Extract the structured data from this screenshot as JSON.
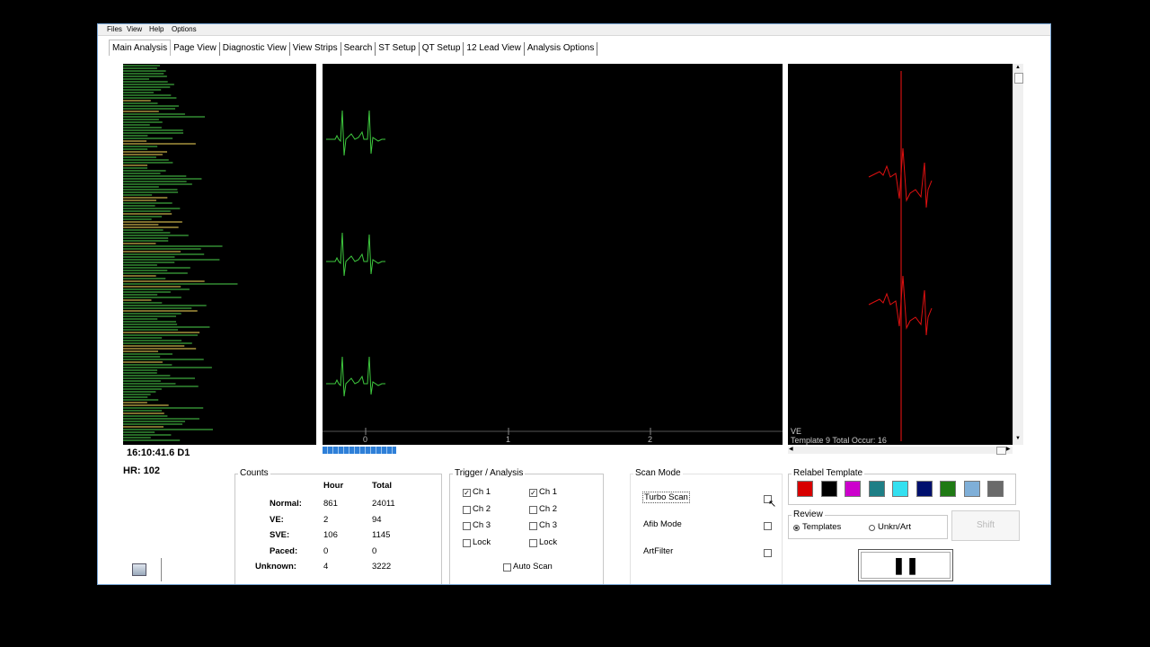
{
  "menu": [
    "Files",
    "View",
    "Help",
    "Options"
  ],
  "tabs": [
    "Main Analysis",
    "Page View",
    "Diagnostic View",
    "View Strips",
    "Search",
    "ST Setup",
    "QT Setup",
    "12 Lead View",
    "Analysis Options"
  ],
  "trend": {
    "time_label": "16:10:41.6 D1",
    "hr_label": "HR:",
    "hr_value": "102"
  },
  "strip": {
    "axis_ticks": [
      "0",
      "1",
      "2"
    ]
  },
  "template": {
    "line1": "VE",
    "line2": "Template 9   Total Occur: 16"
  },
  "counts": {
    "title": "Counts",
    "col_hour": "Hour",
    "col_total": "Total",
    "rows": [
      {
        "label": "Normal:",
        "hour": "861",
        "total": "24011"
      },
      {
        "label": "VE:",
        "hour": "2",
        "total": "94"
      },
      {
        "label": "SVE:",
        "hour": "106",
        "total": "1145"
      },
      {
        "label": "Paced:",
        "hour": "0",
        "total": "0"
      },
      {
        "label": "Unknown:",
        "hour": "4",
        "total": "3222"
      }
    ]
  },
  "trigger": {
    "title": "Trigger / Analysis",
    "left": [
      {
        "label": "Ch 1",
        "checked": true
      },
      {
        "label": "Ch 2",
        "checked": false
      },
      {
        "label": "Ch 3",
        "checked": false
      },
      {
        "label": "Lock",
        "checked": false
      }
    ],
    "right": [
      {
        "label": "Ch 1",
        "checked": true
      },
      {
        "label": "Ch 2",
        "checked": false
      },
      {
        "label": "Ch 3",
        "checked": false
      },
      {
        "label": "Lock",
        "checked": false
      }
    ],
    "auto_scan": "Auto Scan"
  },
  "scan_mode": {
    "title": "Scan Mode",
    "items": [
      "Turbo Scan",
      "Afib Mode",
      "ArtFilter"
    ]
  },
  "relabel": {
    "title": "Relabel Template",
    "colors": [
      "#d80000",
      "#000000",
      "#cc00cc",
      "#1e7f86",
      "#33e0f0",
      "#00106e",
      "#1f7a14",
      "#7fafd8",
      "#6a6a6a"
    ]
  },
  "review": {
    "title": "Review",
    "option1": "Templates",
    "option2": "Unkn/Art",
    "shift_label": "Shift"
  },
  "pause_symbol": "❚❚",
  "colors": {
    "ecg_green": "#3ec83e",
    "template_red": "#e01010",
    "progress_blue": "#2e7fd8"
  }
}
